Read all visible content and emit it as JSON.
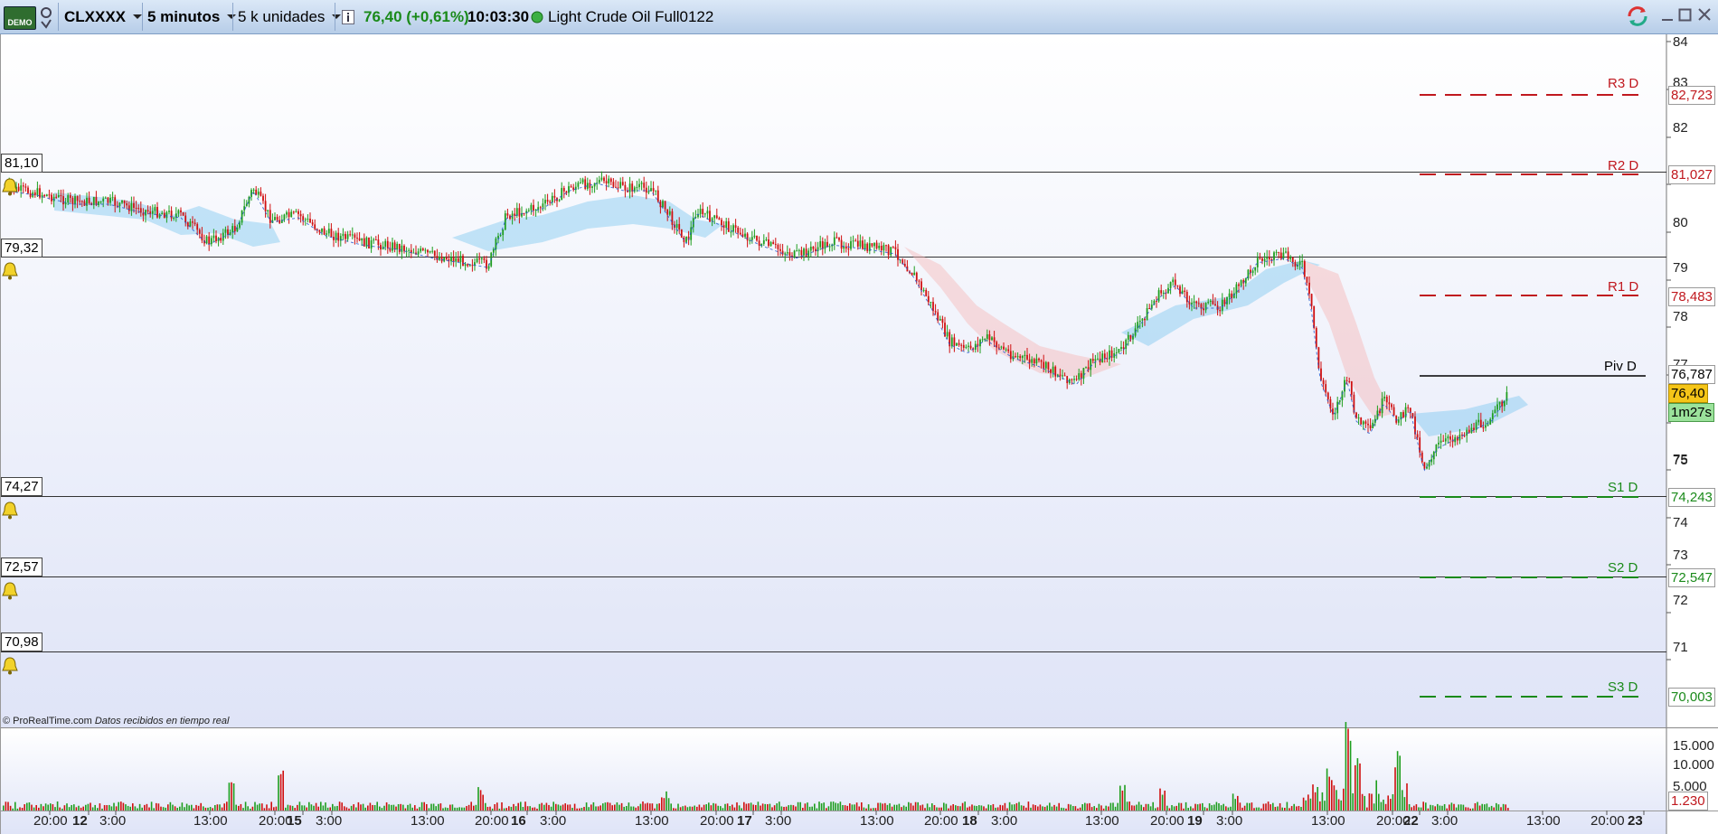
{
  "toolbar": {
    "demo_badge": "DEMO",
    "ticker": "CLXXXX",
    "timeframe": "5 minutos",
    "units": "5 k unidades",
    "price_change": "76,40 (+0,61%)",
    "time": "10:03:30",
    "instrument": "Light Crude Oil Full0122"
  },
  "levels": {
    "l1": "81,10",
    "l2": "79,32",
    "l3": "74,27",
    "l4": "72,57",
    "l5": "70,98"
  },
  "pivots": {
    "r3_name": "R3 D",
    "r3_value": "82,723",
    "r2_name": "R2 D",
    "r2_value": "81,027",
    "r1_name": "R1 D",
    "r1_value": "78,483",
    "piv_name": "Piv D",
    "piv_value": "76,787",
    "s1_name": "S1 D",
    "s1_value": "74,243",
    "s2_name": "S2 D",
    "s2_value": "72,547",
    "s3_name": "S3 D",
    "s3_value": "70,003"
  },
  "price_panel": {
    "last_price": "76,40",
    "countdown": "1m27s",
    "y_ticks": [
      "84",
      "83",
      "82",
      "81",
      "80",
      "79",
      "78",
      "77",
      "76",
      "75",
      "74",
      "73",
      "72",
      "71"
    ]
  },
  "volume_panel": {
    "y_ticks": [
      "15.000",
      "10.000",
      "5.000"
    ],
    "last_volume": "1.230"
  },
  "x_ticks": [
    "20:00",
    "12",
    "3:00",
    "13:00",
    "20:00",
    "15",
    "3:00",
    "13:00",
    "20:00",
    "16",
    "3:00",
    "13:00",
    "20:00",
    "17",
    "3:00",
    "13:00",
    "20:00",
    "18",
    "3:00",
    "13:00",
    "20:00",
    "19",
    "3:00",
    "13:00",
    "20:00",
    "22",
    "3:00",
    "13:00",
    "20:00",
    "23"
  ],
  "footer": {
    "copyright": "© ProRealTime.com",
    "realtime": "Datos recibidos en tiempo real"
  },
  "colors": {
    "up": "#1e9e1e",
    "down": "#d01010",
    "resistance": "#c0181e",
    "support": "#1a8a1a",
    "price_tag": "#f5c518",
    "countdown_tag": "#9be29b"
  }
}
